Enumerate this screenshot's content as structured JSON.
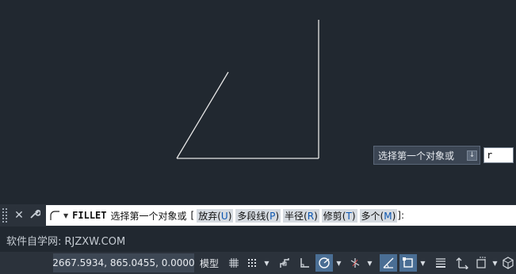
{
  "canvas": {
    "background": "#212830",
    "line_color": "#e6e6e6"
  },
  "dynamic_prompt": {
    "text": "选择第一个对象或",
    "dropdown_icon": "download-arrow-icon",
    "input_value": "r"
  },
  "command_line": {
    "close_icon": "close-icon",
    "customize_icon": "wrench-icon",
    "command_icon": "fillet-arc-icon",
    "command": "FILLET",
    "prompt": "选择第一个对象或",
    "bracket_open": "[",
    "options": [
      {
        "label": "放弃",
        "key": "U"
      },
      {
        "label": "多段线",
        "key": "P"
      },
      {
        "label": "半径",
        "key": "R"
      },
      {
        "label": "修剪",
        "key": "T"
      },
      {
        "label": "多个",
        "key": "M"
      }
    ],
    "bracket_close": "]:"
  },
  "watermark": "软件自学网: RJZXW.COM",
  "status_bar": {
    "coordinates": "2667.5934, 865.0455, 0.0000",
    "model_label": "模型",
    "buttons": [
      "grid-icon",
      "snap-icon",
      "infer-icon",
      "ortho-icon",
      "polar-icon",
      "isometric-icon",
      "osnap-track-icon",
      "osnap-icon",
      "lineweight-icon",
      "transparency-icon",
      "annotation-scale-icon",
      "workspace-icon"
    ],
    "accent": "#4a6e94"
  }
}
